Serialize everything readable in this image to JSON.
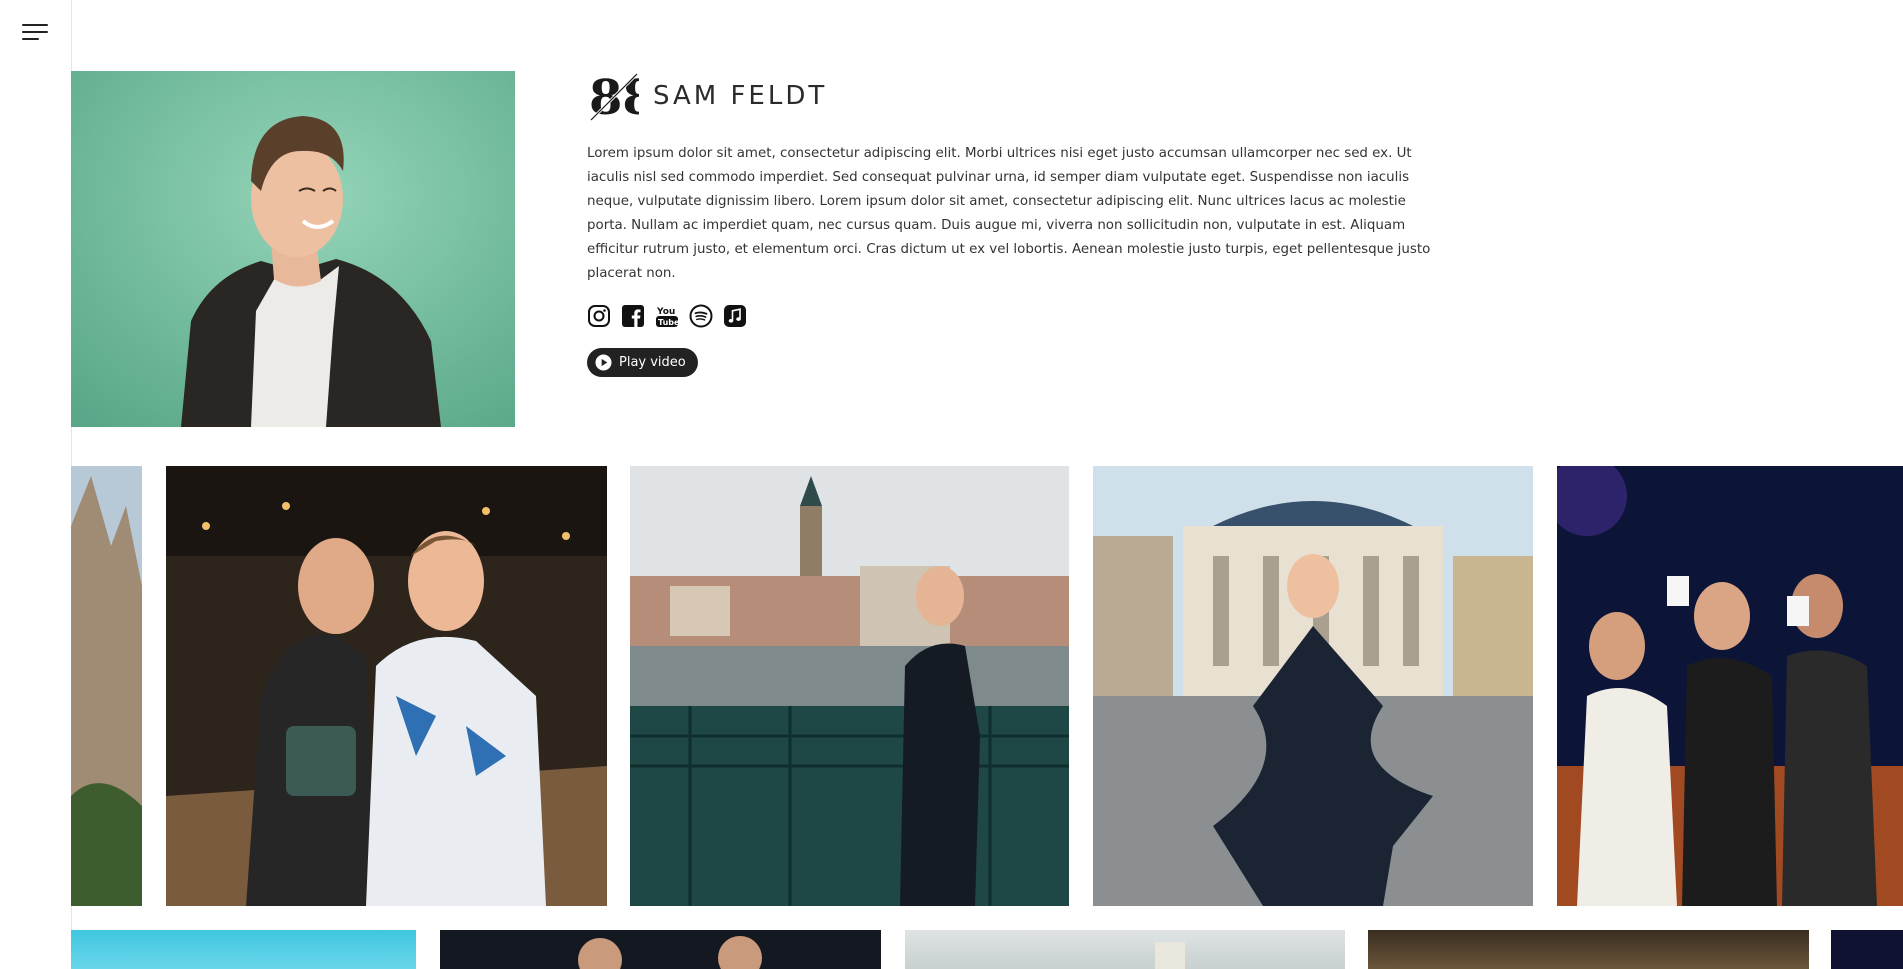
{
  "nav": {
    "menu_icon": "hamburger-menu-icon"
  },
  "profile": {
    "logo_icon": "88-logo-icon",
    "name": "SAM FELDT",
    "bio": "Lorem ipsum dolor sit amet, consectetur adipiscing elit. Morbi ultrices nisi eget justo accumsan ullamcorper nec sed ex. Ut iaculis nisl sed commodo imperdiet. Sed consequat pulvinar urna, id semper diam vulputate eget. Suspendisse non iaculis neque, vulputate dignissim libero. Lorem ipsum dolor sit amet, consectetur adipiscing elit. Nunc ultrices lacus ac molestie porta. Nullam ac imperdiet quam, nec cursus quam. Duis augue mi, viverra non sollicitudin non, vulputate in est. Aliquam efficitur rutrum justo, et elementum orci. Cras dictum ut ex vel lobortis. Aenean molestie justo turpis, eget pellentesque justo placerat non.",
    "socials": [
      "instagram-icon",
      "facebook-icon",
      "youtube-icon",
      "spotify-icon",
      "apple-music-icon"
    ],
    "play_label": "Play video"
  },
  "colors": {
    "accent": "#222222",
    "hero_bg": "#6bbf9d"
  }
}
